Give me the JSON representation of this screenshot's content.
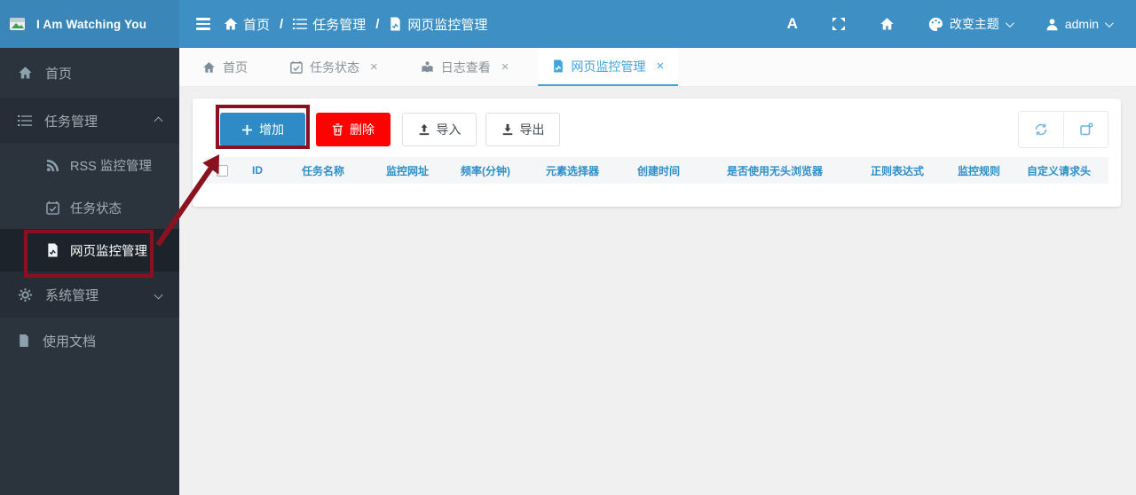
{
  "app": {
    "title": "I Am Watching You"
  },
  "header": {
    "breadcrumb": {
      "separator": "/",
      "items": [
        {
          "label": "首页",
          "icon": "home-icon"
        },
        {
          "label": "任务管理",
          "icon": "list-icon"
        },
        {
          "label": "网页监控管理",
          "icon": "file-chart-icon"
        }
      ]
    },
    "font_button_label": "A",
    "theme_menu_label": "改变主题",
    "user_menu_label": "admin"
  },
  "sidebar": {
    "items": [
      {
        "label": "首页",
        "icon": "home-icon"
      },
      {
        "label": "任务管理",
        "icon": "list-icon",
        "state": "expanded"
      },
      {
        "label": "RSS 监控管理",
        "icon": "rss-icon"
      },
      {
        "label": "任务状态",
        "icon": "calendar-check-icon"
      },
      {
        "label": "网页监控管理",
        "icon": "file-chart-icon",
        "state": "active"
      },
      {
        "label": "系统管理",
        "icon": "gear-icon",
        "state": "collapsed"
      },
      {
        "label": "使用文档",
        "icon": "file-icon"
      }
    ]
  },
  "tabs": {
    "close_glyph": "×",
    "items": [
      {
        "label": "首页",
        "icon": "home-icon",
        "closable": false
      },
      {
        "label": "任务状态",
        "icon": "calendar-check-icon",
        "closable": true
      },
      {
        "label": "日志查看",
        "icon": "log-reader-icon",
        "closable": true
      },
      {
        "label": "网页监控管理",
        "icon": "file-chart-icon",
        "closable": true,
        "active": true
      }
    ]
  },
  "toolbar": {
    "add_label": "增加",
    "delete_label": "删除",
    "import_label": "导入",
    "export_label": "导出"
  },
  "table": {
    "columns": [
      "ID",
      "任务名称",
      "监控网址",
      "频率(分钟)",
      "元素选择器",
      "创建时间",
      "是否使用无头浏览器",
      "正则表达式",
      "监控规则",
      "自定义请求头"
    ]
  },
  "colors": {
    "header_blue": "#3e90c4",
    "logo_blue": "#3a86b8",
    "sidebar_dark": "#2b333c",
    "sidebar_active": "#1c232b",
    "accent_blue": "#2e8bc5",
    "danger_red": "#fe0101",
    "annotation_red": "#8a1220",
    "tab_active_blue": "#41a4da",
    "table_header_text_blue": "#2d8fc8"
  }
}
